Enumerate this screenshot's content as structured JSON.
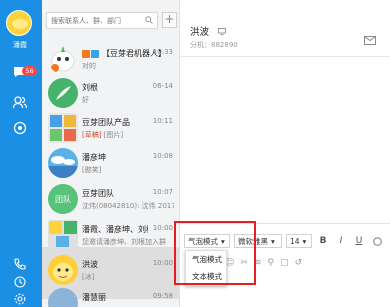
{
  "user": {
    "name": "潘霞",
    "unread": "56"
  },
  "search": {
    "placeholder": "搜索联系人、群、部门",
    "add_label": "+"
  },
  "conversations": [
    {
      "title": "【豆芽君机器人】",
      "time": "10:33",
      "preview": "对的",
      "tag": "",
      "avatar_color": "#ffffff",
      "active": false
    },
    {
      "title": "刘根",
      "time": "06-14",
      "preview": "好",
      "tag": "",
      "avatar_color": "#47b26b",
      "active": false
    },
    {
      "title": "豆芽团队产品",
      "time": "10:11",
      "preview": "[图片]",
      "tag": "[草稿]",
      "avatar_color": "#e7e7e7",
      "active": false
    },
    {
      "title": "潘彦坤",
      "time": "10:08",
      "preview": "[憨笑]",
      "tag": "",
      "avatar_color": "#5bb0e8",
      "active": false
    },
    {
      "title": "豆芽团队",
      "time": "10:07",
      "preview": "沈伟(08042810): 沈伟 2017-06...",
      "tag": "",
      "avatar_color": "#56c27a",
      "active": false
    },
    {
      "title": "潘霞、潘彦坤、刘根",
      "time": "10:00",
      "preview": "您邀请潘彦坤、刘根加入群",
      "tag": "",
      "avatar_color": "#e0e0e0",
      "active": false
    },
    {
      "title": "洪波",
      "time": "10:00",
      "preview": "[冰]",
      "tag": "",
      "avatar_color": "#ffcf3a",
      "active": true
    },
    {
      "title": "潘慧丽",
      "time": "09:58",
      "preview": "",
      "tag": "",
      "avatar_color": "#8ab4d8",
      "active": false
    }
  ],
  "chat": {
    "title": "洪波",
    "subtitle": "分机：882890"
  },
  "fontbar": {
    "mode": "气泡模式",
    "font": "微软雅黑",
    "size": "14",
    "bold": "B",
    "italic": "I",
    "underline": "U"
  },
  "dropdown": {
    "options": [
      "气泡模式",
      "文本模式"
    ]
  },
  "colors": {
    "rail": "#1a8fe3",
    "highlight": "#e32020",
    "badge": "#ff4444"
  }
}
